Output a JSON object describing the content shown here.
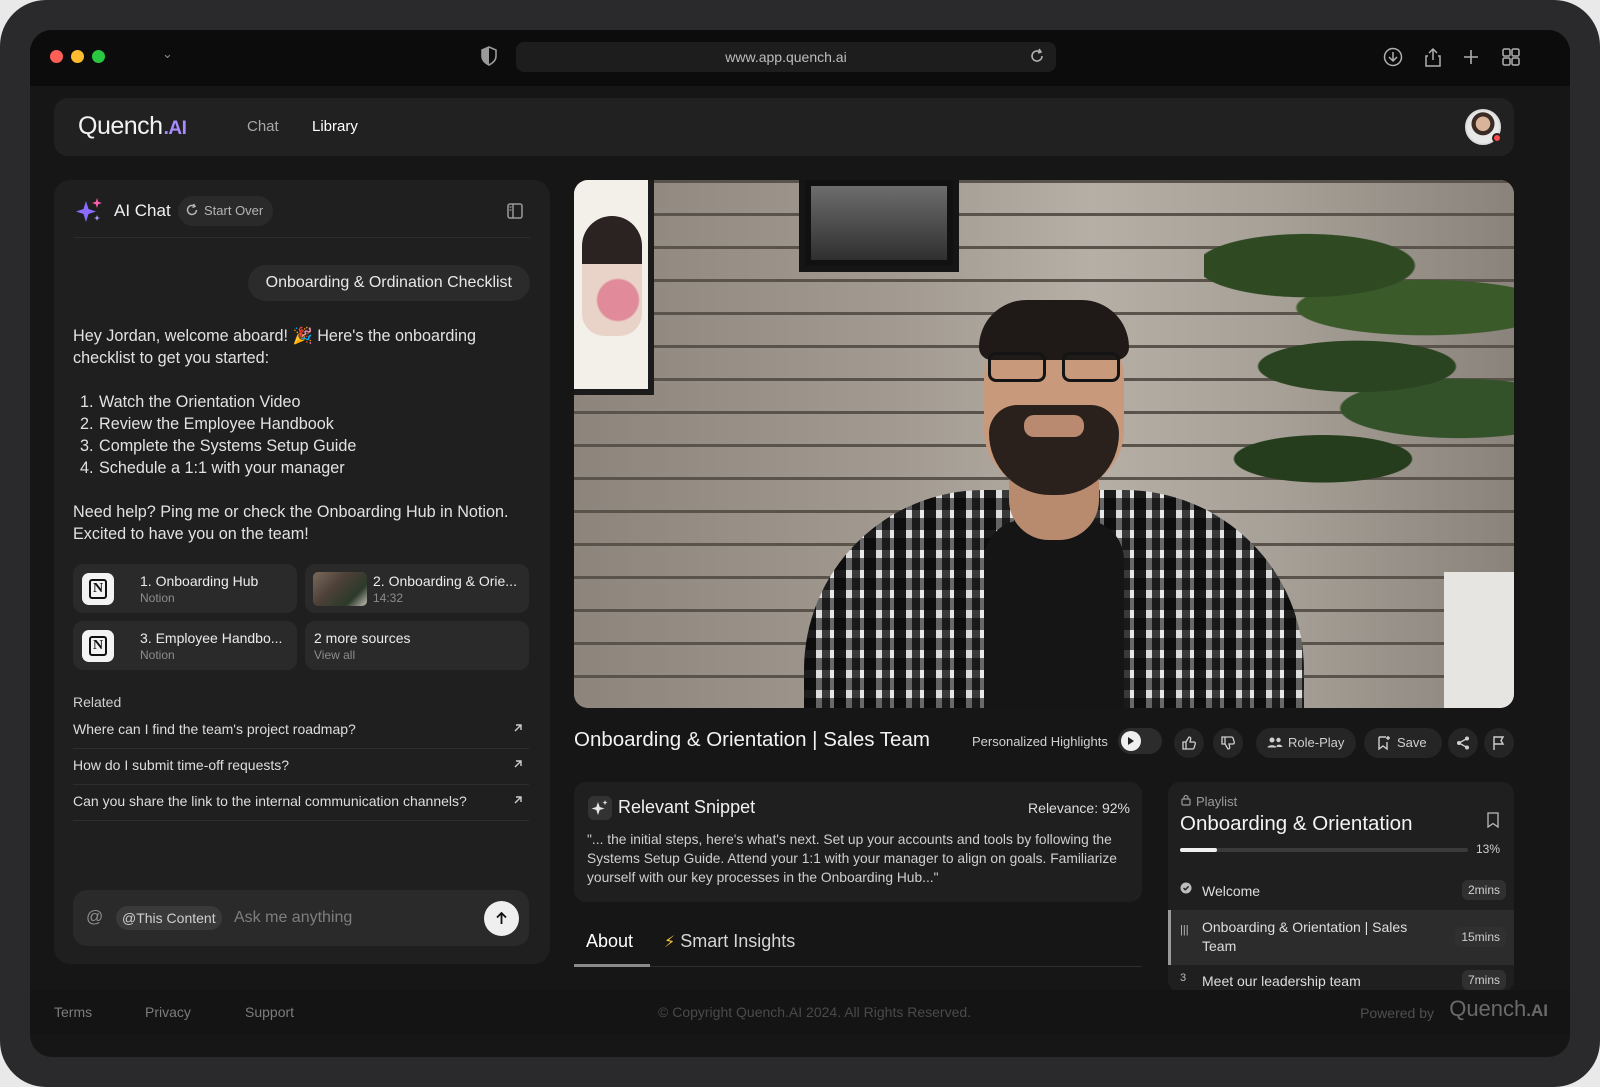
{
  "browser": {
    "url": "www.app.quench.ai",
    "traffic_colors": [
      "#ff5f57",
      "#febc2e",
      "#28c840"
    ]
  },
  "app": {
    "logo_text": "Quench",
    "logo_suffix": ".AI",
    "nav": [
      {
        "label": "Chat",
        "active": false
      },
      {
        "label": "Library",
        "active": true
      }
    ],
    "accent": "#a88cff"
  },
  "chat": {
    "title": "AI Chat",
    "start_over": "Start Over",
    "user_message": "Onboarding & Ordination Checklist",
    "bot_intro": "Hey Jordan, welcome aboard! 🎉 Here's the onboarding checklist to get you started:",
    "checklist": [
      "Watch the Orientation Video",
      "Review the Employee Handbook",
      "Complete the Systems Setup Guide",
      "Schedule a 1:1 with your manager"
    ],
    "bot_outro": "Need help? Ping me or check the Onboarding Hub in Notion. Excited to have you on the team!",
    "sources": [
      {
        "title": "1. Onboarding Hub",
        "subtitle": "Notion",
        "icon": "notion-icon"
      },
      {
        "title": "2. Onboarding & Orie...",
        "subtitle": "14:32",
        "icon": "video-thumbnail"
      },
      {
        "title": "3. Employee Handbo...",
        "subtitle": "Notion",
        "icon": "notion-icon"
      },
      {
        "title": "2 more sources",
        "subtitle": "View all",
        "icon": ""
      }
    ],
    "related_label": "Related",
    "related": [
      "Where can I find the team's project roadmap?",
      "How do I submit time-off requests?",
      "Can you share the link to the internal communication channels?"
    ],
    "composer": {
      "at": "@",
      "chip": "@This Content",
      "placeholder": "Ask me anything"
    }
  },
  "video": {
    "title": "Onboarding & Orientation | Sales Team",
    "personalized_highlights": "Personalized Highlights",
    "role_play": "Role-Play",
    "save": "Save"
  },
  "snippet": {
    "title": "Relevant Snippet",
    "relevance": "Relevance: 92%",
    "body": "\"... the initial steps, here's what's next. Set up your accounts and tools by following the Systems Setup Guide. Attend your 1:1 with your manager to align on goals. Familiarize yourself with our key processes in the Onboarding Hub...\""
  },
  "tabs": [
    {
      "label": "About",
      "active": true
    },
    {
      "label": "Smart Insights",
      "active": false
    }
  ],
  "playlist": {
    "label": "Playlist",
    "title": "Onboarding & Orientation",
    "progress_percent": 13,
    "progress_text": "13%",
    "items": [
      {
        "marker": "✓",
        "name": "Welcome",
        "duration": "2mins",
        "state": "done"
      },
      {
        "marker": "|||",
        "name": "Onboarding & Orientation | Sales Team",
        "duration": "15mins",
        "state": "playing"
      },
      {
        "marker": "3",
        "name": "Meet our leadership team",
        "duration": "7mins",
        "state": "upcoming"
      }
    ]
  },
  "footer": {
    "links": [
      "Terms",
      "Privacy",
      "Support"
    ],
    "copyright": "© Copyright Quench.AI 2024. All Rights Reserved.",
    "powered_by": "Powered by",
    "logo_text": "Quench",
    "logo_suffix": ".AI"
  }
}
